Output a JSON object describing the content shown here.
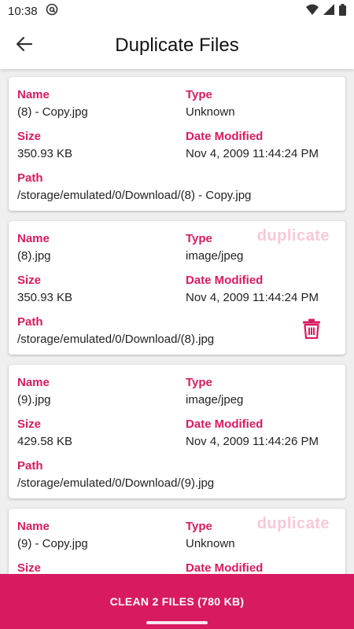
{
  "status_bar": {
    "time": "10:38",
    "icons": [
      "at-sign-icon",
      "wifi-icon",
      "signal-icon",
      "battery-icon"
    ]
  },
  "app_bar": {
    "title": "Duplicate Files",
    "back_icon": "arrow-left-icon"
  },
  "labels": {
    "name": "Name",
    "type": "Type",
    "size": "Size",
    "date_modified": "Date Modified",
    "path": "Path"
  },
  "cards": [
    {
      "name": "(8) - Copy.jpg",
      "type": "Unknown",
      "size": "350.93 KB",
      "date_modified": "Nov 4, 2009 11:44:24 PM",
      "path": "/storage/emulated/0/Download/(8) - Copy.jpg",
      "badge": ""
    },
    {
      "name": "(8).jpg",
      "type": "image/jpeg",
      "size": "350.93 KB",
      "date_modified": "Nov 4, 2009 11:44:24 PM",
      "path": "/storage/emulated/0/Download/(8).jpg",
      "badge": "duplicate"
    },
    {
      "name": "(9).jpg",
      "type": "image/jpeg",
      "size": "429.58 KB",
      "date_modified": "Nov 4, 2009 11:44:26 PM",
      "path": "/storage/emulated/0/Download/(9).jpg",
      "badge": ""
    },
    {
      "name": "(9) - Copy.jpg",
      "type": "Unknown",
      "size": "",
      "date_modified": "",
      "path": "",
      "badge": "duplicate"
    }
  ],
  "clean_button": {
    "label": "CLEAN 2 FILES (780 KB)"
  },
  "colors": {
    "accent": "#d81b60",
    "watermark": "#f8c8d8",
    "list_background": "#efefef"
  }
}
